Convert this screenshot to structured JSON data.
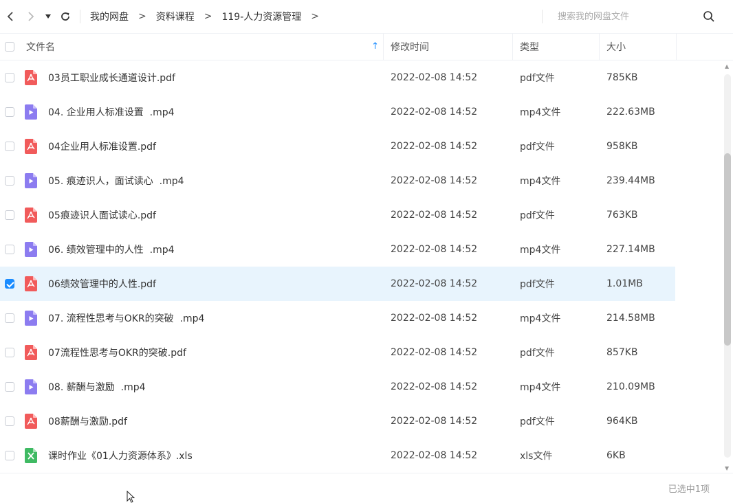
{
  "toolbar": {
    "back_icon": "chevron-left-icon",
    "forward_icon": "chevron-right-icon",
    "history_icon": "caret-down-icon",
    "refresh_icon": "refresh-icon",
    "breadcrumb": [
      "我的网盘",
      "资料课程",
      "119-人力资源管理"
    ],
    "breadcrumb_separator": ">",
    "search_placeholder": "搜索我的网盘文件",
    "search_value": ""
  },
  "columns": {
    "name": "文件名",
    "time": "修改时间",
    "type": "类型",
    "size": "大小",
    "sort_icon": "sort-up-arrow-icon",
    "sort_arrow": "↑"
  },
  "files": [
    {
      "icon": "pdf",
      "name": "03员工职业成长通道设计.pdf",
      "time": "2022-02-08 14:52",
      "type": "pdf文件",
      "size": "785KB",
      "checked": false
    },
    {
      "icon": "video",
      "name": "04. 企业用人标准设置  .mp4",
      "time": "2022-02-08 14:52",
      "type": "mp4文件",
      "size": "222.63MB",
      "checked": false
    },
    {
      "icon": "pdf",
      "name": "04企业用人标准设置.pdf",
      "time": "2022-02-08 14:52",
      "type": "pdf文件",
      "size": "958KB",
      "checked": false
    },
    {
      "icon": "video",
      "name": "05. 痕迹识人，面试读心  .mp4",
      "time": "2022-02-08 14:52",
      "type": "mp4文件",
      "size": "239.44MB",
      "checked": false
    },
    {
      "icon": "pdf",
      "name": "05痕迹识人面试读心.pdf",
      "time": "2022-02-08 14:52",
      "type": "pdf文件",
      "size": "763KB",
      "checked": false
    },
    {
      "icon": "video",
      "name": "06. 绩效管理中的人性  .mp4",
      "time": "2022-02-08 14:52",
      "type": "mp4文件",
      "size": "227.14MB",
      "checked": false
    },
    {
      "icon": "pdf",
      "name": "06绩效管理中的人性.pdf",
      "time": "2022-02-08 14:52",
      "type": "pdf文件",
      "size": "1.01MB",
      "checked": true
    },
    {
      "icon": "video",
      "name": "07. 流程性思考与OKR的突破  .mp4",
      "time": "2022-02-08 14:52",
      "type": "mp4文件",
      "size": "214.58MB",
      "checked": false
    },
    {
      "icon": "pdf",
      "name": "07流程性思考与OKR的突破.pdf",
      "time": "2022-02-08 14:52",
      "type": "pdf文件",
      "size": "857KB",
      "checked": false
    },
    {
      "icon": "video",
      "name": "08. 薪酬与激励  .mp4",
      "time": "2022-02-08 14:52",
      "type": "mp4文件",
      "size": "210.09MB",
      "checked": false
    },
    {
      "icon": "pdf",
      "name": "08薪酬与激励.pdf",
      "time": "2022-02-08 14:52",
      "type": "pdf文件",
      "size": "964KB",
      "checked": false
    },
    {
      "icon": "excel",
      "name": "课时作业《01人力资源体系》.xls",
      "time": "2022-02-08 14:52",
      "type": "xls文件",
      "size": "6KB",
      "checked": false
    }
  ],
  "status": {
    "selection_text": "已选中1项"
  },
  "colors": {
    "accent": "#1a8cff",
    "selected_row": "#e8f4fd",
    "pdf": "#f15b5b",
    "video": "#8c7cf0",
    "excel": "#3fba63"
  }
}
